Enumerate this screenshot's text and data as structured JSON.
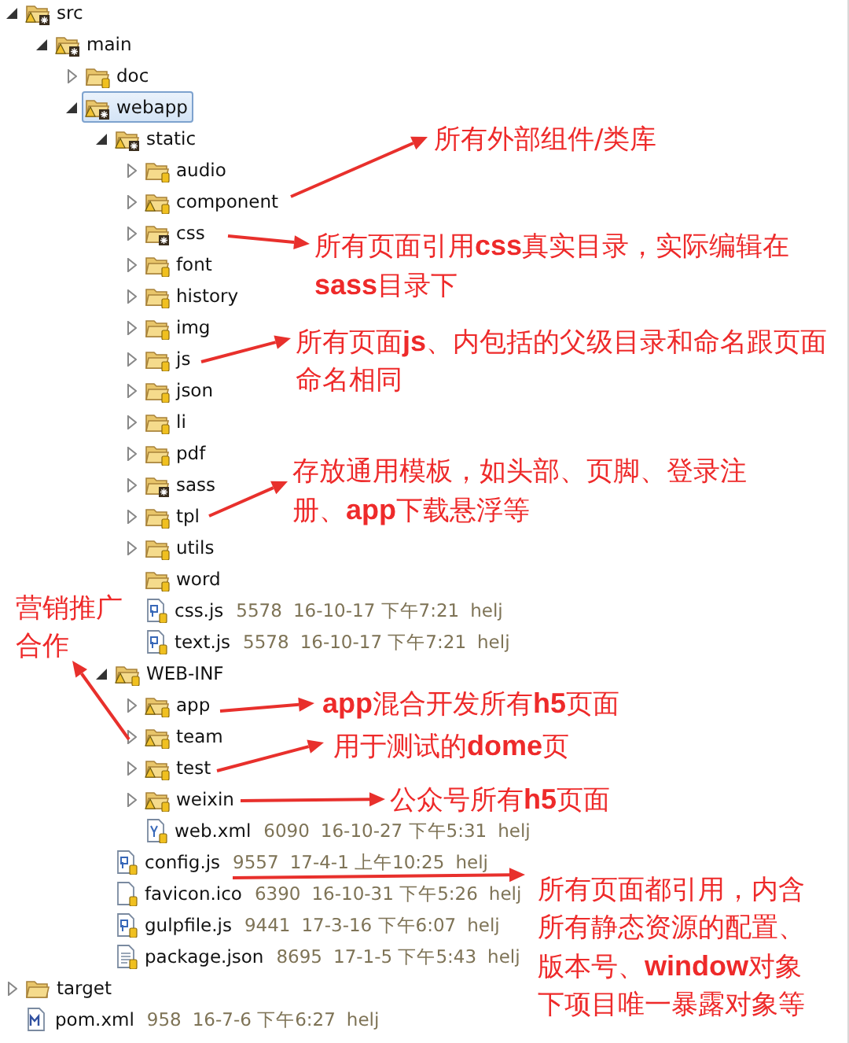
{
  "tree": [
    {
      "name": "src",
      "kind": "warn-badge-folder",
      "expanded": true,
      "selected": false,
      "children": [
        {
          "name": "main",
          "kind": "warn-badge-folder",
          "expanded": true,
          "selected": false,
          "children": [
            {
              "name": "doc",
              "kind": "folder",
              "expanded": false,
              "selected": false
            },
            {
              "name": "webapp",
              "kind": "warn-badge-folder",
              "expanded": true,
              "selected": true,
              "children": [
                {
                  "name": "static",
                  "kind": "warn-badge-folder",
                  "expanded": true,
                  "selected": false,
                  "children": [
                    {
                      "name": "audio",
                      "kind": "folder",
                      "expanded": false,
                      "selected": false
                    },
                    {
                      "name": "component",
                      "kind": "warn-folder",
                      "expanded": false,
                      "selected": false
                    },
                    {
                      "name": "css",
                      "kind": "badge-folder",
                      "expanded": false,
                      "selected": false
                    },
                    {
                      "name": "font",
                      "kind": "folder",
                      "expanded": false,
                      "selected": false
                    },
                    {
                      "name": "history",
                      "kind": "folder",
                      "expanded": false,
                      "selected": false
                    },
                    {
                      "name": "img",
                      "kind": "folder",
                      "expanded": false,
                      "selected": false
                    },
                    {
                      "name": "js",
                      "kind": "folder",
                      "expanded": false,
                      "selected": false
                    },
                    {
                      "name": "json",
                      "kind": "folder",
                      "expanded": false,
                      "selected": false
                    },
                    {
                      "name": "li",
                      "kind": "folder",
                      "expanded": false,
                      "selected": false
                    },
                    {
                      "name": "pdf",
                      "kind": "folder",
                      "expanded": false,
                      "selected": false
                    },
                    {
                      "name": "sass",
                      "kind": "badge-folder",
                      "expanded": false,
                      "selected": false
                    },
                    {
                      "name": "tpl",
                      "kind": "folder",
                      "expanded": false,
                      "selected": false
                    },
                    {
                      "name": "utils",
                      "kind": "folder",
                      "expanded": false,
                      "selected": false
                    },
                    {
                      "name": "word",
                      "kind": "leaf-folder",
                      "selected": false
                    },
                    {
                      "name": "css.js",
                      "kind": "script-file",
                      "size": "5578",
                      "date": "16-10-17 下午7:21",
                      "author": "helj",
                      "selected": false
                    },
                    {
                      "name": "text.js",
                      "kind": "script-file",
                      "size": "5578",
                      "date": "16-10-17 下午7:21",
                      "author": "helj",
                      "selected": false
                    }
                  ]
                },
                {
                  "name": "WEB-INF",
                  "kind": "warn-folder",
                  "expanded": true,
                  "selected": false,
                  "children": [
                    {
                      "name": "app",
                      "kind": "warn-folder",
                      "expanded": false,
                      "selected": false
                    },
                    {
                      "name": "team",
                      "kind": "warn-folder",
                      "expanded": false,
                      "selected": false
                    },
                    {
                      "name": "test",
                      "kind": "warn-folder",
                      "expanded": false,
                      "selected": false
                    },
                    {
                      "name": "weixin",
                      "kind": "warn-folder",
                      "expanded": false,
                      "selected": false
                    },
                    {
                      "name": "web.xml",
                      "kind": "xml-file",
                      "size": "6090",
                      "date": "16-10-27 下午5:31",
                      "author": "helj",
                      "selected": false
                    }
                  ]
                },
                {
                  "name": "config.js",
                  "kind": "script-file",
                  "size": "9557",
                  "date": "17-4-1 上午10:25",
                  "author": "helj",
                  "selected": false
                },
                {
                  "name": "favicon.ico",
                  "kind": "plain-file",
                  "size": "6390",
                  "date": "16-10-31 下午5:26",
                  "author": "helj",
                  "selected": false
                },
                {
                  "name": "gulpfile.js",
                  "kind": "script-file",
                  "size": "9441",
                  "date": "17-3-16 下午6:07",
                  "author": "helj",
                  "selected": false
                },
                {
                  "name": "package.json",
                  "kind": "text-file",
                  "size": "8695",
                  "date": "17-1-5 下午5:43",
                  "author": "helj",
                  "selected": false
                }
              ]
            }
          ]
        }
      ]
    },
    {
      "name": "target",
      "kind": "plain-folder",
      "expanded": false,
      "selected": false
    },
    {
      "name": "pom.xml",
      "kind": "maven-file",
      "size": "958",
      "date": "16-7-6 下午6:27",
      "author": "helj",
      "selected": false
    }
  ],
  "annotations": [
    {
      "text": "所有外部组件/类库"
    },
    {
      "text": "所有页面引用**css**真实目录，实际编辑在**sass**目录下"
    },
    {
      "text": "所有页面**js**、内包括的父级目录和命名跟页面命名相同"
    },
    {
      "text": "存放通用模板，如头部、页脚、登录注册、**app**下载悬浮等"
    },
    {
      "text": "营销推广合作"
    },
    {
      "text": "**app**混合开发所有**h5**页面"
    },
    {
      "text": "用于测试的**dome**页"
    },
    {
      "text": "公众号所有**h5**页面"
    },
    {
      "text": "所有页面都引用，内含所有静态资源的配置、版本号、**window**对象下项目唯一暴露对象等"
    }
  ]
}
